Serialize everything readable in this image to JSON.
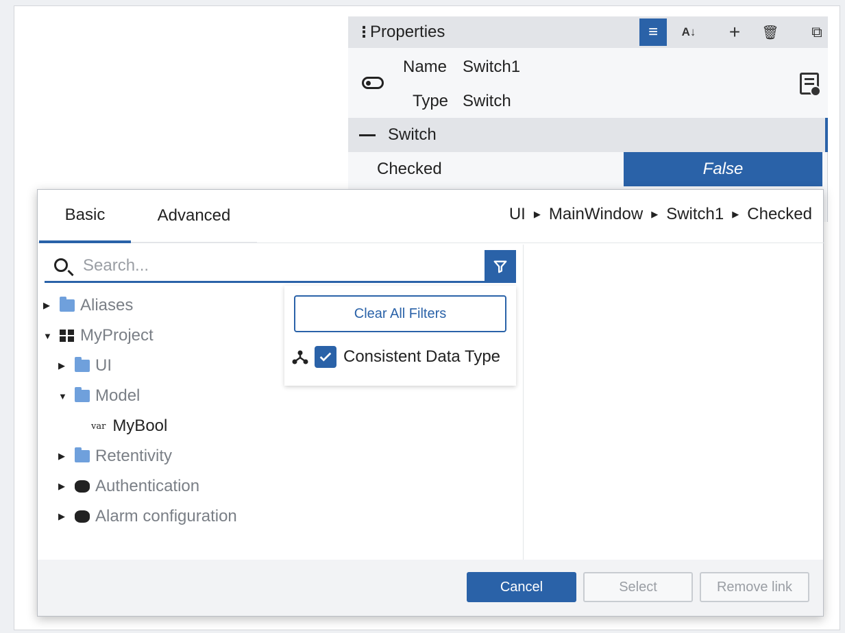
{
  "properties": {
    "title": "Properties",
    "name_label": "Name",
    "name_value": "Switch1",
    "type_label": "Type",
    "type_value": "Switch",
    "section": "Switch",
    "checked_label": "Checked",
    "checked_value": "False",
    "toolbar_icons": [
      "filter-icon",
      "sort-az-icon",
      "add-icon",
      "trash-icon",
      "copy-icon"
    ]
  },
  "dialog": {
    "tabs": [
      "Basic",
      "Advanced"
    ],
    "active_tab": "Basic",
    "breadcrumb": [
      "UI",
      "MainWindow",
      "Switch1",
      "Checked"
    ],
    "search": {
      "placeholder": "Search..."
    },
    "filter": {
      "clear_label": "Clear All Filters",
      "option_label": "Consistent Data Type",
      "option_checked": true
    },
    "tree": [
      {
        "label": "Aliases",
        "expanded": false
      },
      {
        "label": "MyProject",
        "expanded": true
      },
      {
        "label": "UI",
        "expanded": false
      },
      {
        "label": "Model",
        "expanded": true
      },
      {
        "label": "MyBool",
        "tag": "var"
      },
      {
        "label": "Retentivity",
        "expanded": false
      },
      {
        "label": "Authentication",
        "expanded": false
      },
      {
        "label": "Alarm configuration",
        "expanded": false
      }
    ],
    "buttons": {
      "cancel": "Cancel",
      "select": "Select",
      "remove": "Remove link"
    }
  },
  "colors": {
    "accent": "#2a62a8",
    "muted_text": "#7a7f86",
    "folder": "#6fa0dc"
  }
}
